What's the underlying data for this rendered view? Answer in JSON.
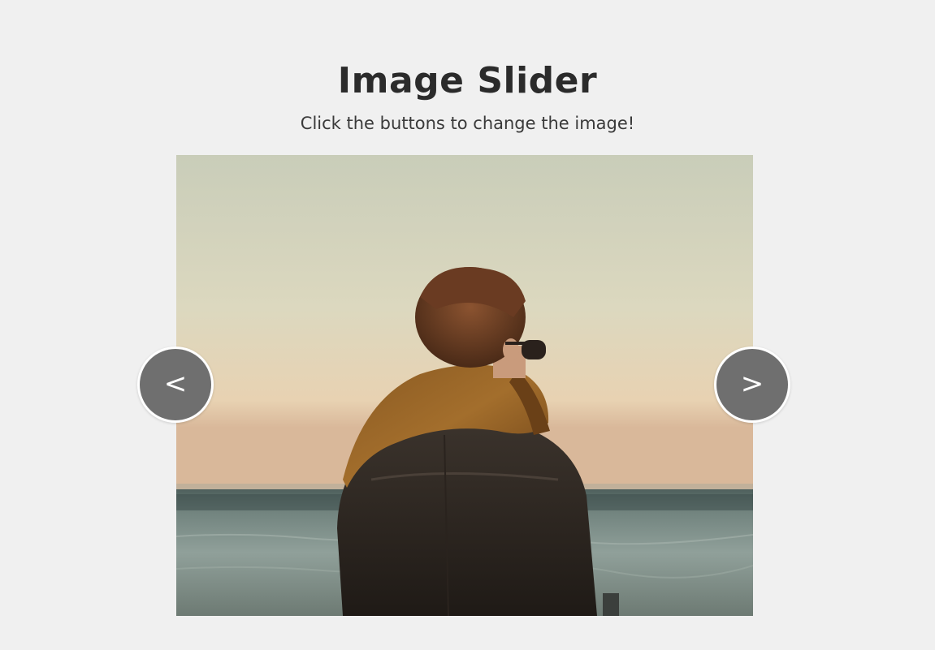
{
  "header": {
    "title": "Image Slider",
    "subtitle": "Click the buttons to change the image!"
  },
  "slider": {
    "image_alt": "Person in leather jacket and scarf looking at the sea at sunset",
    "prev_label": "<",
    "next_label": ">"
  },
  "colors": {
    "background": "#f0f0f0",
    "button_fill": "#6f6f6f",
    "button_border": "#ffffff",
    "title_text": "#2b2b2b"
  }
}
